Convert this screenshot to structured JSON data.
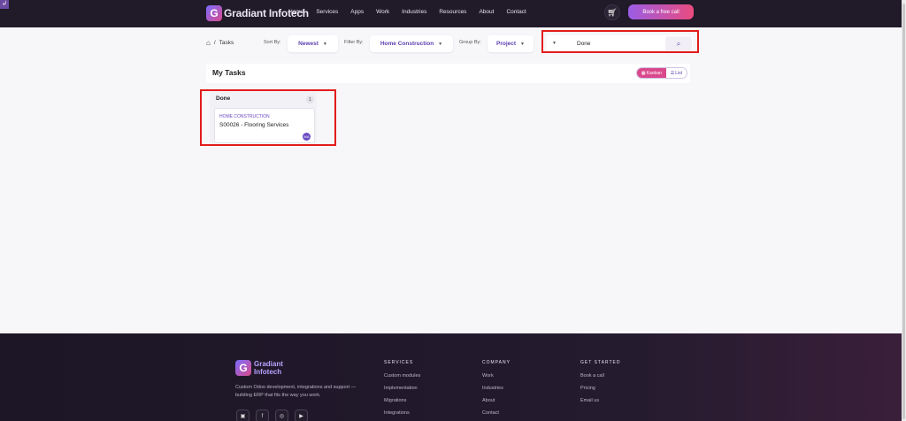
{
  "colors": {
    "nav_bg": "#211a29",
    "accent_purple": "#5a3fb0",
    "cta_start": "#9b5de5",
    "cta_end": "#e94b7e",
    "highlight": "#e31c1c"
  },
  "nav": {
    "brand": "Gradiant Infotech",
    "links": [
      "Home",
      "Services",
      "Apps",
      "Work",
      "Industries",
      "Resources",
      "About",
      "Contact"
    ],
    "cart_icon": "cart-icon",
    "cta": "Book a free call"
  },
  "toolbar": {
    "breadcrumb_current": "Tasks",
    "sort_label": "Sort By:",
    "sort_value": "Newest",
    "filter_label": "Filter By:",
    "filter_value": "Home Construction",
    "group_label": "Group By:",
    "group_value": "Project",
    "search_value": "Done"
  },
  "tasks": {
    "title": "My Tasks",
    "view_kanban": "Kanban",
    "view_list": "List"
  },
  "kanban": {
    "column_title": "Done",
    "count": "1",
    "card": {
      "project": "HOME CONSTRUCTION",
      "name": "S00026 - Flooring Services",
      "avatar": "MA"
    }
  },
  "footer": {
    "brand": "Gradiant Infotech",
    "description": "Custom Odoo development, integrations and support — building ERP that fits the way you work.",
    "services_title": "SERVICES",
    "services": [
      "Custom modules",
      "Implementation",
      "Migrations",
      "Integrations"
    ],
    "company_title": "COMPANY",
    "company": [
      "Work",
      "Industries",
      "About",
      "Contact"
    ],
    "get_started_title": "GET STARTED",
    "get_started": [
      "Book a call",
      "Pricing",
      "Email us"
    ]
  }
}
